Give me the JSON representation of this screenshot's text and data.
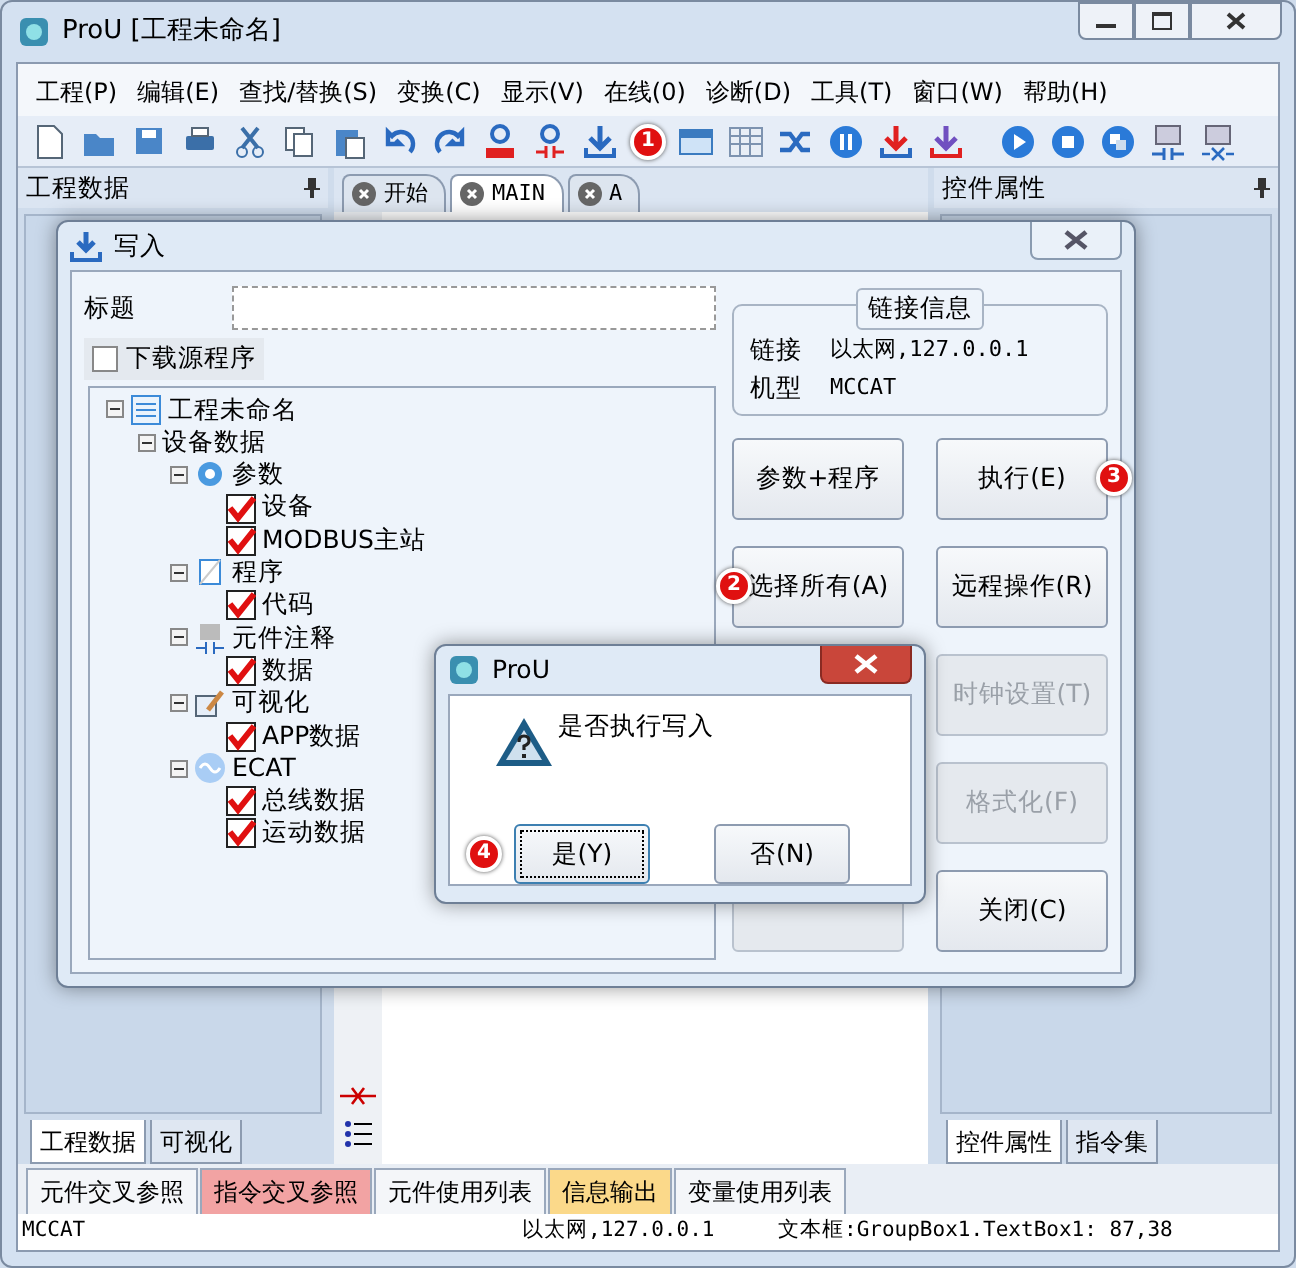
{
  "window": {
    "title": "ProU [工程未命名]"
  },
  "menu": [
    "工程(P)",
    "编辑(E)",
    "查找/替换(S)",
    "变换(C)",
    "显示(V)",
    "在线(0)",
    "诊断(D)",
    "工具(T)",
    "窗口(W)",
    "帮助(H)"
  ],
  "toolbar": {
    "badge": "1"
  },
  "left_panel": {
    "title": "工程数据",
    "tabs": [
      {
        "label": "工程数据",
        "selected": true
      },
      {
        "label": "可视化",
        "selected": false
      }
    ]
  },
  "editor_tabs": [
    {
      "label": "开始",
      "selected": false
    },
    {
      "label": "MAIN",
      "selected": true
    },
    {
      "label": "A",
      "selected": false
    }
  ],
  "right_panel": {
    "title": "控件属性",
    "tabs": [
      {
        "label": "控件属性",
        "selected": true
      },
      {
        "label": "指令集",
        "selected": false
      }
    ]
  },
  "bottom_tabs": [
    {
      "label": "元件交叉参照",
      "color": "#f4f6f9"
    },
    {
      "label": "指令交叉参照",
      "color": "#f2a3a3"
    },
    {
      "label": "元件使用列表",
      "color": "#f4f6f9"
    },
    {
      "label": "信息输出",
      "color": "#fbd98a"
    },
    {
      "label": "变量使用列表",
      "color": "#f4f6f9"
    }
  ],
  "status_bar": [
    "MCCAT",
    "以太网,127.0.0.1",
    "文本框:GroupBox1.TextBox1: 87,38"
  ],
  "write_dialog": {
    "title": "写入",
    "title_label": "标题",
    "download_source": {
      "label": "下载源程序",
      "checked": false
    },
    "tree": [
      {
        "label": "工程未命名",
        "expanded": true,
        "children": [
          {
            "label": "设备数据",
            "expanded": true,
            "children": [
              {
                "label": "参数",
                "expanded": true,
                "children": [
                  {
                    "label": "设备",
                    "checked": true
                  },
                  {
                    "label": "MODBUS主站",
                    "checked": true
                  }
                ]
              },
              {
                "label": "程序",
                "expanded": true,
                "children": [
                  {
                    "label": "代码",
                    "checked": true
                  }
                ]
              },
              {
                "label": "元件注释",
                "expanded": true,
                "children": [
                  {
                    "label": "数据",
                    "checked": true
                  }
                ]
              },
              {
                "label": "可视化",
                "expanded": true,
                "children": [
                  {
                    "label": "APP数据",
                    "checked": true
                  }
                ]
              },
              {
                "label": "ECAT",
                "expanded": true,
                "children": [
                  {
                    "label": "总线数据",
                    "checked": true
                  },
                  {
                    "label": "运动数据",
                    "checked": true
                  }
                ]
              }
            ]
          }
        ]
      }
    ],
    "link_info": {
      "title": "链接信息",
      "rows": [
        {
          "label": "链接",
          "value": "以太网,127.0.0.1"
        },
        {
          "label": "机型",
          "value": "MCCAT"
        }
      ]
    },
    "button_rows": [
      {
        "left": {
          "label": "参数+程序",
          "disabled": false
        },
        "right": {
          "label": "执行(E)",
          "disabled": false,
          "badge": "3"
        }
      },
      {
        "left": {
          "label": "选择所有(A)",
          "disabled": false,
          "badge": "2"
        },
        "right": {
          "label": "远程操作(R)",
          "disabled": false
        }
      },
      {
        "right": {
          "label": "时钟设置(T)",
          "disabled": true
        }
      },
      {
        "right": {
          "label": "格式化(F)",
          "disabled": true
        }
      },
      {
        "left": {
          "disabled": true
        },
        "right": {
          "label": "关闭(C)",
          "disabled": false
        }
      }
    ]
  },
  "message_box": {
    "title": "ProU",
    "message": "是否执行写入",
    "buttons": [
      {
        "label": "是(Y)",
        "focused": true,
        "badge": "4"
      },
      {
        "label": "否(N)",
        "focused": false
      }
    ]
  }
}
